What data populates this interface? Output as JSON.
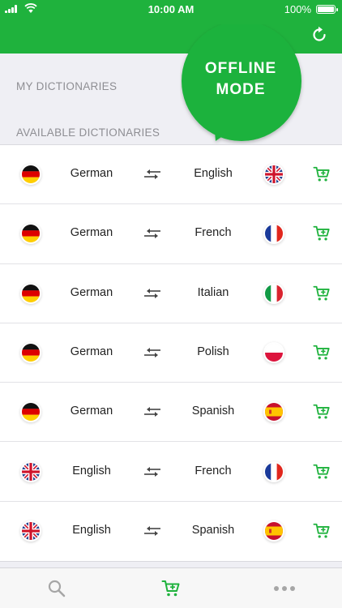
{
  "status_bar": {
    "time": "10:00 AM",
    "battery": "100%"
  },
  "sections": {
    "my_dictionaries": "MY DICTIONARIES",
    "available_dictionaries": "AVAILABLE DICTIONARIES"
  },
  "offline_badge": {
    "line1": "OFFLINE",
    "line2": "MODE"
  },
  "dictionaries": [
    {
      "from": "German",
      "to": "English",
      "from_flag": "germany-flag",
      "to_flag": "uk-flag"
    },
    {
      "from": "German",
      "to": "French",
      "from_flag": "germany-flag",
      "to_flag": "france-flag"
    },
    {
      "from": "German",
      "to": "Italian",
      "from_flag": "germany-flag",
      "to_flag": "italy-flag"
    },
    {
      "from": "German",
      "to": "Polish",
      "from_flag": "germany-flag",
      "to_flag": "poland-flag"
    },
    {
      "from": "German",
      "to": "Spanish",
      "from_flag": "germany-flag",
      "to_flag": "spain-flag"
    },
    {
      "from": "English",
      "to": "French",
      "from_flag": "uk-flag",
      "to_flag": "france-flag"
    },
    {
      "from": "English",
      "to": "Spanish",
      "from_flag": "uk-flag",
      "to_flag": "spain-flag"
    }
  ],
  "icons": {
    "swap": "swap-arrows-icon",
    "cart": "cart-icon",
    "refresh": "refresh-icon",
    "tab_search": "search-icon",
    "tab_shop": "cart-icon",
    "tab_more": "more-dots-icon"
  },
  "colors": {
    "brand_green": "#1fb23d",
    "background": "#efeff4",
    "section_text": "#8e8e93",
    "tab_inactive": "#a6a6a6"
  }
}
